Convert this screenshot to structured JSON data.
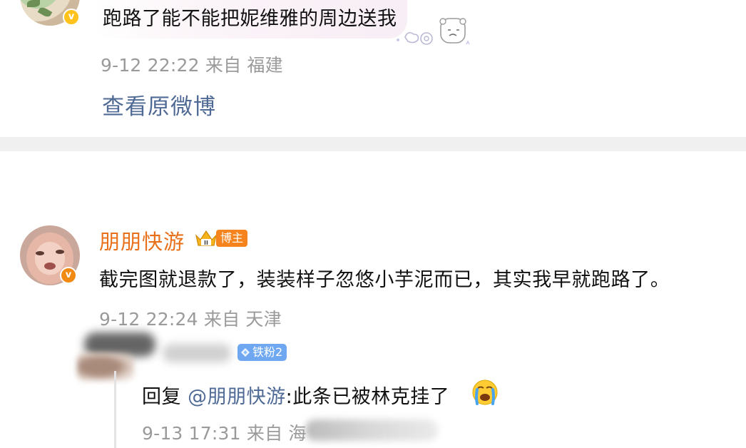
{
  "top_comment": {
    "text": "跑路了能不能把妮维雅的周边送我",
    "meta": "9-12 22:22 来自 福建",
    "view_original": "查看原微博"
  },
  "main_comment": {
    "author": "朋朋快游",
    "badge": "博主",
    "text": "截完图就退款了，装装样子忽悠小芋泥而已，其实我早就跑路了。",
    "meta": "9-12 22:24 来自 天津"
  },
  "reply": {
    "fan_badge": "铁粉2",
    "prefix": "回复 ",
    "mention": "@朋朋快游",
    "text": ":此条已被林克挂了",
    "meta": "9-13 17:31 来自 海"
  },
  "colors": {
    "accent_orange": "#e8701a",
    "link_blue": "#506a96",
    "meta_gray": "#9a9a9a",
    "fan_badge_blue": "#6fa8f0",
    "verified_yellow": "#ffc21a"
  },
  "icons": {
    "verified": "verified-v-icon",
    "crown": "crown-level-icon",
    "fan": "gem-icon",
    "emoji": "crying-face-icon"
  }
}
